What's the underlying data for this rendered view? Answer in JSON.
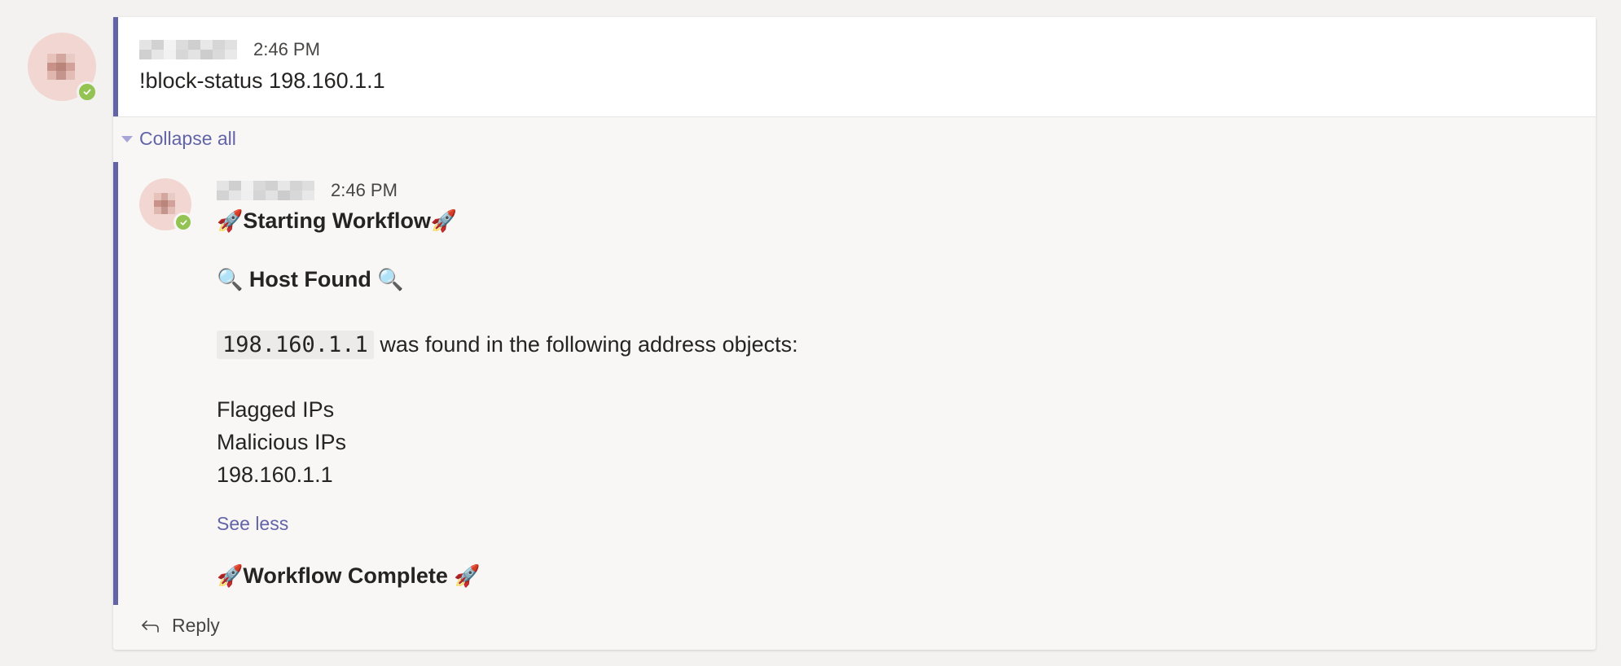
{
  "root_message": {
    "timestamp": "2:46 PM",
    "text": "!block-status 198.160.1.1"
  },
  "collapse_label": "Collapse all",
  "reply": {
    "timestamp": "2:46 PM",
    "start": {
      "emoji_left": "🚀",
      "text": "Starting Workflow",
      "emoji_right": "🚀"
    },
    "host": {
      "emoji_left": "🔍",
      "text": "Host Found",
      "emoji_right": "🔍"
    },
    "ip_code": "198.160.1.1",
    "found_text": " was found in the following address objects:",
    "objects": [
      "Flagged IPs",
      "Malicious IPs",
      "198.160.1.1"
    ],
    "see_less": "See less",
    "complete": {
      "emoji_left": "🚀",
      "text": "Workflow Complete ",
      "emoji_right": "🚀"
    }
  },
  "reply_button": "Reply",
  "colors": {
    "accent": "#6264a7",
    "presence": "#92c353",
    "avatar_bg": "#f1d6d1"
  }
}
